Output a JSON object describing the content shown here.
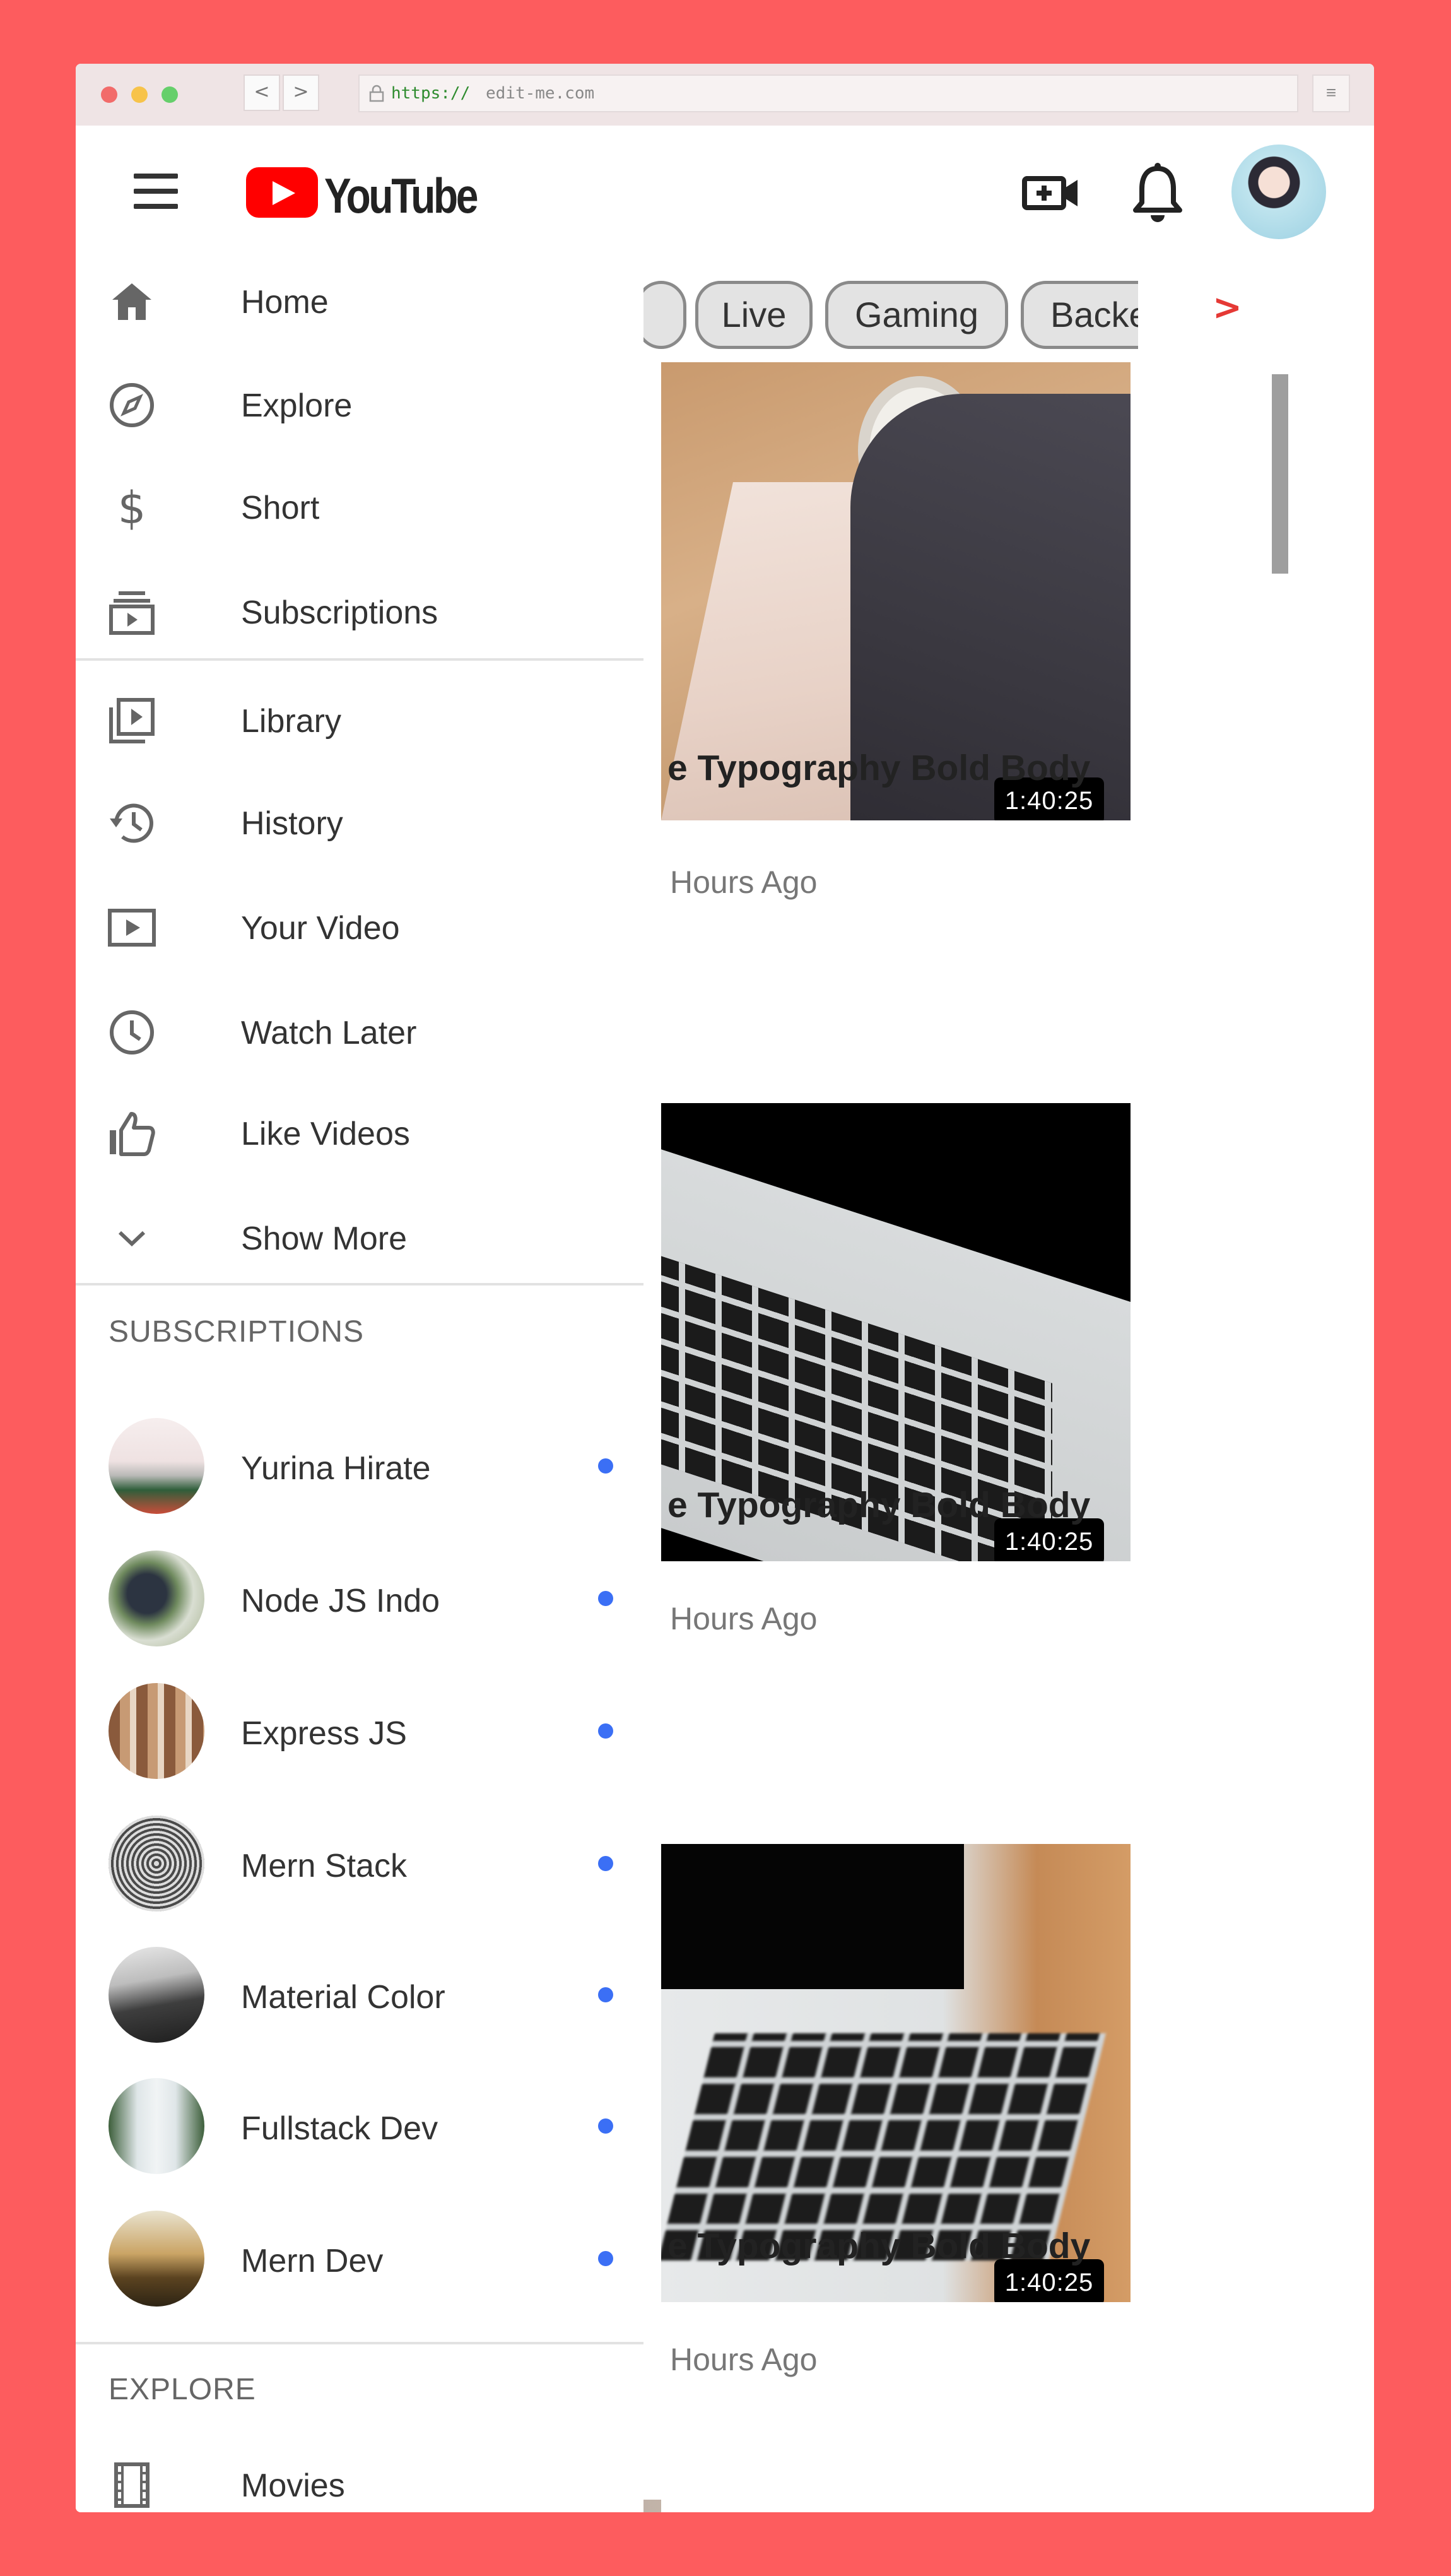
{
  "browser": {
    "url_scheme": "https://",
    "url_host": "edit-me.com",
    "back_label": "<",
    "forward_label": ">",
    "menu_label": "≡",
    "lock_icon": "lock-icon",
    "dot_colors": [
      "#f26b6a",
      "#f7c34a",
      "#66cf6b"
    ]
  },
  "header": {
    "logo_text": "YouTube",
    "logo_color": "#ff0000",
    "icons": [
      "hamburger-icon",
      "create-video-icon",
      "bell-icon",
      "avatar"
    ]
  },
  "chips": [
    "",
    "Live",
    "Gaming",
    "Backend"
  ],
  "chip_next_label": ">",
  "sidebar": {
    "items_group1": [
      {
        "label": "Home",
        "icon": "home-icon"
      },
      {
        "label": "Explore",
        "icon": "explore-icon"
      },
      {
        "label": "Short",
        "icon": "dollar-icon"
      },
      {
        "label": "Subscriptions",
        "icon": "subscriptions-icon"
      }
    ],
    "items_group2": [
      {
        "label": "Library",
        "icon": "library-icon"
      },
      {
        "label": "History",
        "icon": "history-icon"
      },
      {
        "label": "Your Video",
        "icon": "your-video-icon"
      },
      {
        "label": "Watch Later",
        "icon": "clock-icon"
      },
      {
        "label": "Like Videos",
        "icon": "thumbs-up-icon"
      },
      {
        "label": "Show More",
        "icon": "chevron-down-icon"
      }
    ],
    "subscriptions_title": "SUBSCRIPTIONS",
    "subscriptions": [
      {
        "name": "Yurina Hirate"
      },
      {
        "name": "Node JS Indo"
      },
      {
        "name": "Express JS"
      },
      {
        "name": "Mern Stack"
      },
      {
        "name": "Material Color"
      },
      {
        "name": "Fullstack Dev"
      },
      {
        "name": "Mern Dev"
      }
    ],
    "explore_title": "EXPLORE",
    "explore_items": [
      {
        "label": "Movies",
        "icon": "film-icon"
      }
    ]
  },
  "videos": [
    {
      "title": "e Typography Bold Body",
      "meta": "Hours Ago",
      "duration": "1:40:25"
    },
    {
      "title": "e Typography Bold Body",
      "meta": "Hours Ago",
      "duration": "1:40:25"
    },
    {
      "title": "e Typography Bold Body",
      "meta": "Hours Ago",
      "duration": "1:40:25"
    }
  ],
  "colors": {
    "background": "#fd5c5e",
    "accent": "#ff0000",
    "new_dot": "#3b6ff5"
  }
}
